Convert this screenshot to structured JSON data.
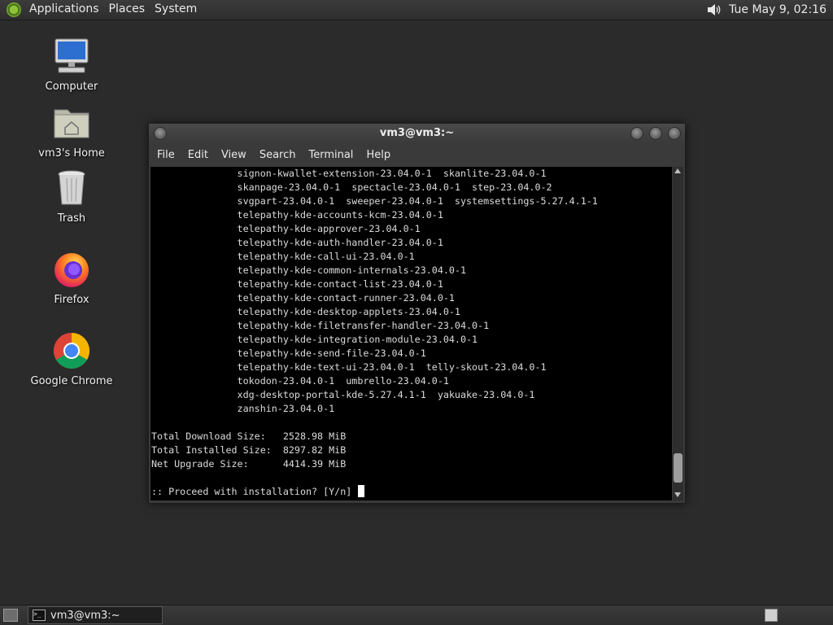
{
  "top_panel": {
    "menus": [
      "Applications",
      "Places",
      "System"
    ],
    "clock": "Tue May  9, 02:16",
    "volume_icon": "speaker-icon"
  },
  "desktop_icons": [
    {
      "label": "Computer",
      "icon": "computer-icon"
    },
    {
      "label": "vm3's Home",
      "icon": "home-folder-icon"
    },
    {
      "label": "Trash",
      "icon": "trash-icon"
    },
    {
      "label": "Firefox",
      "icon": "firefox-icon"
    },
    {
      "label": "Google Chrome",
      "icon": "chrome-icon"
    }
  ],
  "terminal": {
    "title": "vm3@vm3:~",
    "menu": [
      "File",
      "Edit",
      "View",
      "Search",
      "Terminal",
      "Help"
    ],
    "lines": [
      "               signon-kwallet-extension-23.04.0-1  skanlite-23.04.0-1",
      "               skanpage-23.04.0-1  spectacle-23.04.0-1  step-23.04.0-2",
      "               svgpart-23.04.0-1  sweeper-23.04.0-1  systemsettings-5.27.4.1-1",
      "               telepathy-kde-accounts-kcm-23.04.0-1",
      "               telepathy-kde-approver-23.04.0-1",
      "               telepathy-kde-auth-handler-23.04.0-1",
      "               telepathy-kde-call-ui-23.04.0-1",
      "               telepathy-kde-common-internals-23.04.0-1",
      "               telepathy-kde-contact-list-23.04.0-1",
      "               telepathy-kde-contact-runner-23.04.0-1",
      "               telepathy-kde-desktop-applets-23.04.0-1",
      "               telepathy-kde-filetransfer-handler-23.04.0-1",
      "               telepathy-kde-integration-module-23.04.0-1",
      "               telepathy-kde-send-file-23.04.0-1",
      "               telepathy-kde-text-ui-23.04.0-1  telly-skout-23.04.0-1",
      "               tokodon-23.04.0-1  umbrello-23.04.0-1",
      "               xdg-desktop-portal-kde-5.27.4.1-1  yakuake-23.04.0-1",
      "               zanshin-23.04.0-1",
      "",
      "Total Download Size:   2528.98 MiB",
      "Total Installed Size:  8297.82 MiB",
      "Net Upgrade Size:      4414.39 MiB",
      ""
    ],
    "prompt": ":: Proceed with installation? [Y/n] "
  },
  "taskbar": {
    "task_label": "vm3@vm3:~"
  }
}
